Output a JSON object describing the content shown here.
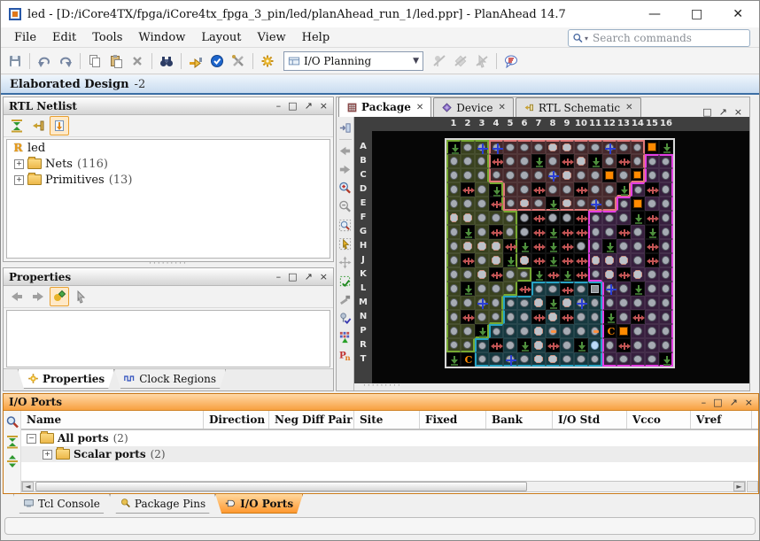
{
  "window": {
    "title": "led - [D:/iCore4TX/fpga/iCore4tx_fpga_3_pin/led/planAhead_run_1/led.ppr] - PlanAhead 14.7"
  },
  "menu": {
    "items": [
      "File",
      "Edit",
      "Tools",
      "Window",
      "Layout",
      "View",
      "Help"
    ],
    "search_placeholder": "Search commands"
  },
  "toolbar": {
    "mode": "I/O Planning",
    "icons_left": [
      "save",
      "|",
      "undo",
      "redo",
      "|",
      "copy",
      "paste",
      "delete",
      "|",
      "binoculars",
      "|",
      "route-pin",
      "check-circle",
      "tools",
      "|",
      "gear"
    ],
    "icons_right": [
      "unfix-disabled",
      "swap-disabled",
      "deselect-disabled",
      "|",
      "drc-bubble"
    ]
  },
  "banner": {
    "title": "Elaborated Design",
    "suffix": "-2"
  },
  "rtl_netlist": {
    "title": "RTL Netlist",
    "toolbar": [
      "collapse-all",
      "sync-selection",
      "!scroll-to"
    ],
    "tree": [
      {
        "label": "led",
        "count": ""
      },
      {
        "label": "Nets",
        "count": "(116)"
      },
      {
        "label": "Primitives",
        "count": "(13)"
      }
    ]
  },
  "properties": {
    "title": "Properties",
    "toolbar": [
      "back",
      "forward",
      "!gear-diamond",
      "select-cursor"
    ],
    "tabs": [
      "Properties",
      "Clock Regions"
    ]
  },
  "package_view": {
    "tabs": [
      {
        "label": "Package",
        "active": true
      },
      {
        "label": "Device",
        "active": false
      },
      {
        "label": "RTL Schematic",
        "active": false
      }
    ],
    "side_toolbar": [
      "dock",
      "|",
      "back",
      "forward",
      "zoom-in",
      "zoom-out",
      "zoom-area",
      "select-area",
      "fit-view",
      "autofit",
      "hammer",
      "validate",
      "bga-grid",
      "pn-labels"
    ],
    "grid": {
      "cols": [
        "1",
        "2",
        "3",
        "4",
        "5",
        "6",
        "7",
        "8",
        "9",
        "10",
        "11",
        "12",
        "13",
        "14",
        "15",
        "16"
      ],
      "rows": [
        "A",
        "B",
        "C",
        "D",
        "E",
        "F",
        "G",
        "H",
        "J",
        "K",
        "L",
        "M",
        "N",
        "P",
        "R",
        "T"
      ],
      "cells": [
        "g.bb...hh..b..Og",
        "...r..g.rhg.r...",
        ".......bh..O.O..",
        ".r.g..r..r..g.r.",
        "...r.h.gh.b..O..",
        "hh....r..r...gr.",
        ".g.r..rgrr..r.g.",
        ".hhhrgrgr..g..r.",
        ".r.hghrgrrhhh.r.",
        "..hr..grgr.hrh..",
        ".g...r..r.sb.g..",
        "..b...hghb......",
        ".r....rhr..g.r..",
        "..g...hd..dCO...",
        "...r.ghr.gc.r...",
        "gC..b.hh.......g"
      ],
      "regions": [
        "GGGPPPPPPPPPPPDD",
        "GGGPPPPPPPPPPPMM",
        "GGGPPPPPPPPPPPMM",
        "GGGGPPPPPPPPPMMM",
        "GGGGPPPPPPPPMMMM",
        "GGGGGDDDDDMMMMMM",
        "GGGGGDDDDDMMMMMM",
        "GGGGGDDDDDMMMMMM",
        "GGGGGDDDDDMMMMMM",
        "GGGGGGDDDDMMMMMM",
        "GGGGGDTTTTTMMMMM",
        "GGGGTTTTTTTMMMMM",
        "GGGGTTTTTTTMMMMM",
        "GGGTTTTTTTTMMMMM",
        "GGTTTTTTTTTMMMMM",
        "DDTTTTTTTTTMMMMM"
      ],
      "region_bg_colors": {
        "G": "#39411f",
        "P": "#45282b",
        "M": "#371f3e",
        "T": "#16383f",
        "D": "#0b0b0b"
      },
      "region_outline_colors": {
        "G": "#76a832",
        "P": "#e07878",
        "M": "#e33fe3",
        "T": "#27a3c4"
      },
      "legend": {
        ".": "user-io-pin",
        "h": "multi-function-pin",
        "b": "clock-capable-pin",
        "g": "ground-pin",
        "r": "vcc-io-pin",
        "O": "power-pin-selected",
        "C": "config-pin",
        "c": "selected-pin",
        "d": "no-connect-pin",
        "s": "gray-pad"
      }
    }
  },
  "io_ports": {
    "title": "I/O Ports",
    "toolbar": [
      "search",
      "collapse-all",
      "expand-all"
    ],
    "columns": [
      "Name",
      "Direction",
      "Neg Diff Pair",
      "Site",
      "Fixed",
      "Bank",
      "I/O Std",
      "Vcco",
      "Vref"
    ],
    "rows": [
      {
        "label": "All ports",
        "count": "(2)",
        "level": 0,
        "expander": "-"
      },
      {
        "label": "Scalar ports",
        "count": "(2)",
        "level": 1,
        "expander": "+"
      }
    ]
  },
  "bottom_tabs": [
    {
      "label": "Tcl Console",
      "active": false
    },
    {
      "label": "Package Pins",
      "active": false
    },
    {
      "label": "I/O Ports",
      "active": true
    }
  ],
  "colors": {
    "accent_orange": "#ff8a00",
    "banner_blue": "#3c6ea5",
    "title_gradient_top": "#ffd9a8"
  }
}
